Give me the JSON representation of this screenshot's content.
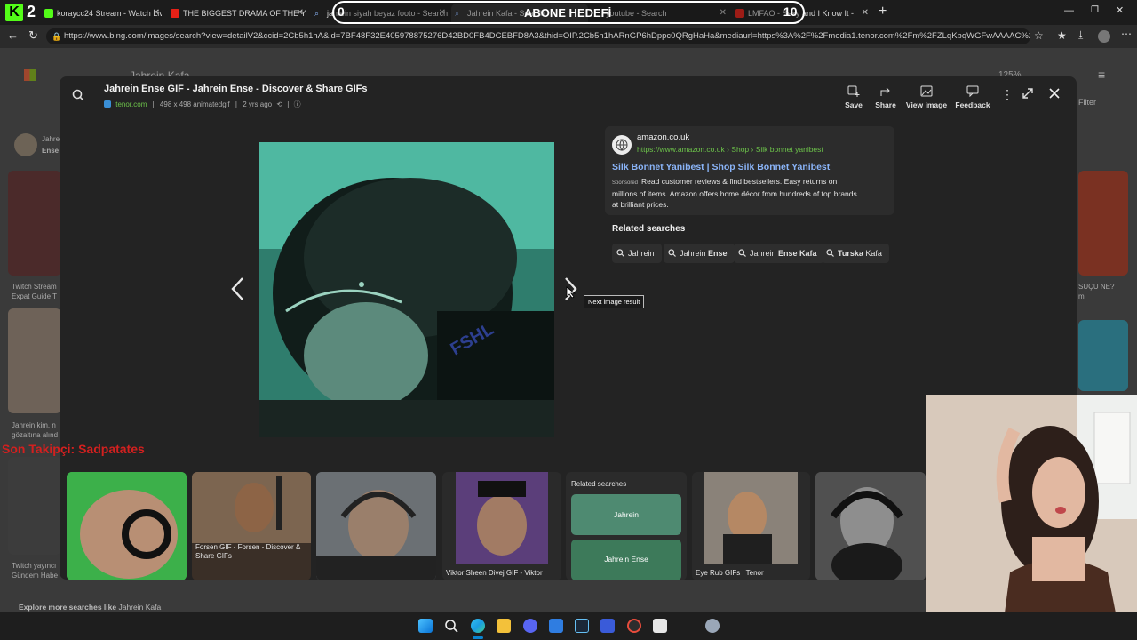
{
  "browser": {
    "tabs": [
      {
        "label": "koraycc24 Stream - Watch Liv",
        "active": false
      },
      {
        "label": "THE BIGGEST DRAMA OF THE YEA",
        "active": false
      },
      {
        "label": "jahrein siyah beyaz footo - Search",
        "active": false
      },
      {
        "label": "Jahrein Kafa - Search",
        "active": true
      },
      {
        "label": "youtube - Search",
        "active": false
      },
      {
        "label": "LMFAO - Sexy and I Know It -",
        "active": false
      }
    ],
    "url": "https://www.bing.com/images/search?view=detailV2&ccid=2Cb5h1hA&id=7BF48F32E405978875276D42BD0FB4DCEBFD8A3&thid=OIP.2Cb5h1hARnGP6hDppc0QRgHaHa&mediaurl=https%3A%2F%2Fmedia1.tenor.com%2Fm%2FZLqKbqWGFwAAAAC%2Fjahr..."
  },
  "overlay": {
    "logo_number": "2",
    "subscriber_goal_current": "0",
    "subscriber_goal_label": "ABONE HEDEFİ",
    "subscriber_goal_target": "10",
    "last_follower": "Son Takipçi: Sadpatates"
  },
  "background_page": {
    "search_text": "Jahrein Kafa",
    "zoom": "125%",
    "filter_label": "Filter",
    "left_items": [
      "Jahre",
      "Ense",
      "Twitch Stream",
      "Expat Guide T",
      "Jahrein kim, n",
      "gözaltına alınd",
      "Twitch yayıncı",
      "Gündem Habe"
    ],
    "right_items": [
      "SUÇU NE?",
      "m"
    ],
    "explore_more": "Explore more searches like",
    "explore_query": "Jahrein Kafa"
  },
  "modal": {
    "title": "Jahrein Ense GIF - Jahrein Ense - Discover & Share GIFs",
    "source": "tenor.com",
    "meta_size": "498 x 498 animatedgif",
    "meta_age": "2 yrs ago",
    "toolbar": {
      "save": "Save",
      "share": "Share",
      "view_image": "View image",
      "feedback": "Feedback"
    },
    "ad": {
      "domain": "amazon.co.uk",
      "breadcrumb": "https://www.amazon.co.uk › Shop › Silk bonnet yanibest",
      "headline": "Silk Bonnet Yanibest | Shop Silk Bonnet Yanibest",
      "sponsored": "Sponsored",
      "desc_line1": "Read customer reviews & find bestsellers. Easy returns on",
      "desc_line2": "millions of items. Amazon offers home décor from hundreds of top brands",
      "desc_line3": "at brilliant prices."
    },
    "related_title": "Related searches",
    "related_chips": [
      {
        "plain": "Jahrein",
        "bold": ""
      },
      {
        "plain": "Jahrein ",
        "bold": "Ense"
      },
      {
        "plain": "Jahrein ",
        "bold": "Ense Kafa"
      },
      {
        "plain": "",
        "bold": "Turska",
        "rest": " Kafa"
      }
    ],
    "next_tooltip": "Next image result"
  },
  "thumbnails": {
    "captions": {
      "forsen": "Forsen GIF - Forsen - Discover & Share GIFs",
      "viktor": "Viktor Sheen Divej GIF - Viktor",
      "eyerub": "Eye Rub GIFs | Tenor"
    },
    "related_title": "Related searches",
    "related_items": [
      "Jahrein",
      "Jahrein Ense"
    ]
  },
  "colors": {
    "link_blue": "#8ab4f8",
    "green_text": "#6cc24a",
    "follower_red": "#d3201f",
    "accent_edge": "#0a84d0"
  }
}
